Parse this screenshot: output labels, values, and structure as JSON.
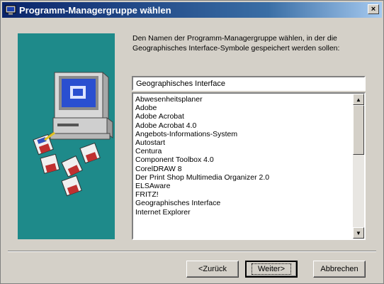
{
  "window": {
    "title": "Programm-Managergruppe wählen",
    "close_label": "×"
  },
  "description": "Den Namen der Programm-Managergruppe wählen, in der die Geographisches Interface-Symbole gespeichert werden sollen:",
  "group_field": {
    "value": "Geographisches Interface"
  },
  "group_list": {
    "items": [
      "Abwesenheitsplaner",
      "Adobe",
      "Adobe Acrobat",
      "Adobe Acrobat 4.0",
      "Angebots-Informations-System",
      "Autostart",
      "Centura",
      "Component Toolbox 4.0",
      "CorelDRAW 8",
      "Der Print Shop Multimedia Organizer 2.0",
      "ELSAware",
      "FRITZ!",
      "Geographisches Interface",
      "Internet Explorer"
    ]
  },
  "buttons": {
    "back": "<Zurück",
    "next": "Weiter>",
    "cancel": "Abbrechen"
  },
  "icons": {
    "title": "setup-icon",
    "art": "computer-with-disks-icon"
  },
  "colors": {
    "title_start": "#0a246a",
    "title_end": "#a6caf0",
    "art_background": "#1e8a8a",
    "face": "#d4d0c8"
  }
}
